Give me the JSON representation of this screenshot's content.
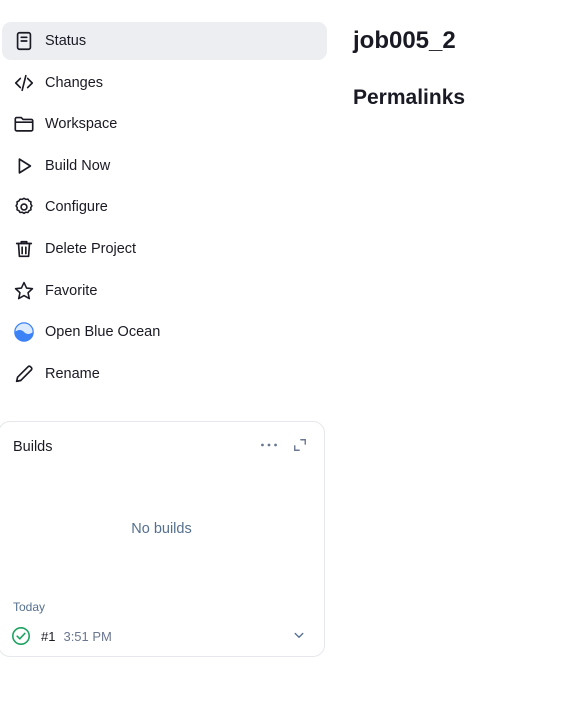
{
  "sidebar": {
    "items": [
      {
        "label": "Status",
        "icon": "status-document-icon",
        "active": true
      },
      {
        "label": "Changes",
        "icon": "code-brackets-icon"
      },
      {
        "label": "Workspace",
        "icon": "folder-icon"
      },
      {
        "label": "Build Now",
        "icon": "play-icon"
      },
      {
        "label": "Configure",
        "icon": "gear-icon"
      },
      {
        "label": "Delete Project",
        "icon": "trash-icon"
      },
      {
        "label": "Favorite",
        "icon": "star-icon"
      },
      {
        "label": "Open Blue Ocean",
        "icon": "blue-ocean-icon"
      },
      {
        "label": "Rename",
        "icon": "pencil-icon"
      }
    ]
  },
  "builds": {
    "title": "Builds",
    "empty_text": "No builds",
    "group_label": "Today",
    "items": [
      {
        "number": "#1",
        "time": "3:51 PM",
        "status": "success"
      }
    ]
  },
  "main": {
    "title": "job005_2",
    "permalinks_heading": "Permalinks"
  },
  "colors": {
    "active_bg": "#eceef2",
    "text": "#1a1a24",
    "muted_blue": "#55708f",
    "success_green": "#1ea363",
    "ocean_blue": "#3b82f6"
  }
}
